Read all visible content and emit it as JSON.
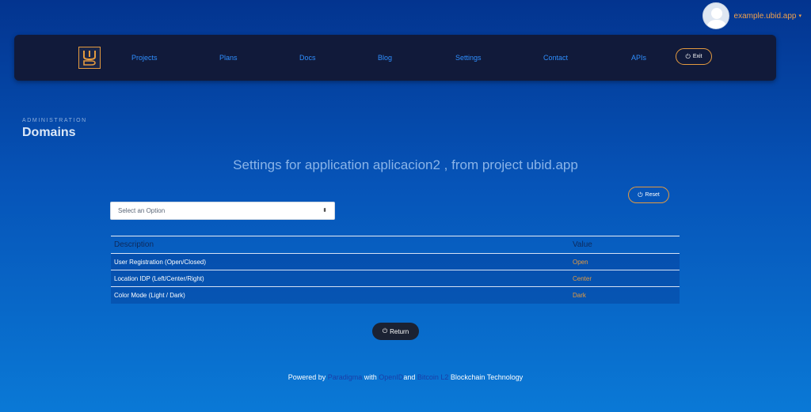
{
  "user": {
    "name": "example.ubid.app",
    "caret": "▾"
  },
  "nav": {
    "logo_text": "UID",
    "items": [
      {
        "label": "Projects"
      },
      {
        "label": "Plans"
      },
      {
        "label": "Docs"
      },
      {
        "label": "Blog"
      },
      {
        "label": "Settings"
      },
      {
        "label": "Contact"
      },
      {
        "label": "APIs"
      }
    ],
    "exit_label": "Exit"
  },
  "header": {
    "section": "ADMINISTRATION",
    "title": "Domains",
    "settings_heading": "Settings for application aplicacion2 , from project ubid.app"
  },
  "reset_label": "Reset",
  "select": {
    "selected": "Select an Option",
    "arrows": "⬍"
  },
  "table": {
    "headers": {
      "description": "Description",
      "value": "Value"
    },
    "rows": [
      {
        "description": "User Registration (Open/Closed)",
        "value": "Open"
      },
      {
        "description": "Location IDP (Left/Center/Right)",
        "value": "Center"
      },
      {
        "description": "Color Mode (Light / Dark)",
        "value": "Dark"
      }
    ]
  },
  "return_label": "Return",
  "footer": {
    "prefix": "Powered by ",
    "link1": "Paradigma",
    "mid1": " with ",
    "link2": "OpenID",
    "mid2": "and ",
    "link3": "Bitcoin L2",
    "suffix": " Blockchain Technology"
  },
  "icons": {
    "power": "⏻"
  },
  "colors": {
    "accent": "#e49a3f",
    "nav_bg": "#111a3a",
    "link_blue": "#2f8fff"
  }
}
